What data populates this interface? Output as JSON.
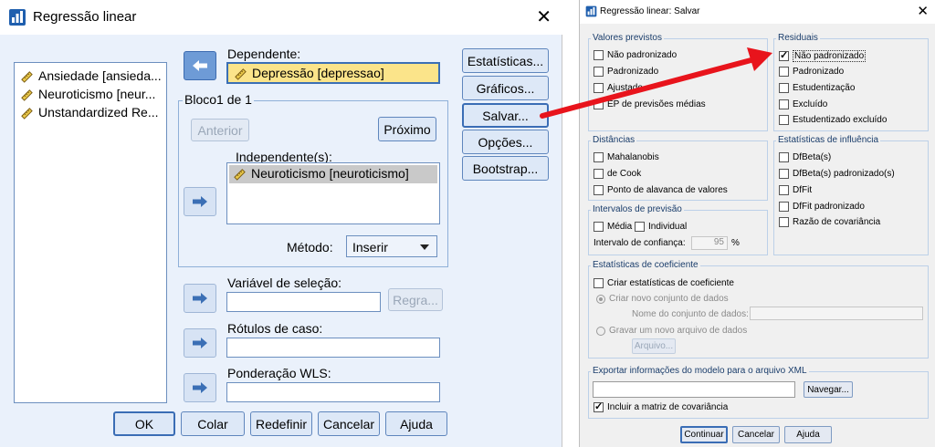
{
  "main_dialog": {
    "title": "Regressão linear",
    "variables": [
      {
        "label": "Ansiedade [ansieda..."
      },
      {
        "label": "Neuroticismo [neur..."
      },
      {
        "label": "Unstandardized Re..."
      }
    ],
    "dependent_label": "Dependente:",
    "dependent_value": "Depressão [depressao]",
    "block_title": "Bloco1 de  1",
    "previous_label": "Anterior",
    "next_label": "Próximo",
    "independent_label": "Independente(s):",
    "independent_values": [
      "Neuroticismo [neuroticismo]"
    ],
    "method_label": "Método:",
    "method_value": "Inserir",
    "selection_label": "Variável de seleção:",
    "rule_label": "Regra...",
    "case_labels_label": "Rótulos de caso:",
    "wls_label": "Ponderação WLS:",
    "side_buttons": [
      "Estatísticas...",
      "Gráficos...",
      "Salvar...",
      "Opções...",
      "Bootstrap..."
    ],
    "footer_buttons": [
      "OK",
      "Colar",
      "Redefinir",
      "Cancelar",
      "Ajuda"
    ]
  },
  "save_dialog": {
    "title": "Regressão linear: Salvar",
    "predicted": {
      "title": "Valores previstos",
      "options": [
        {
          "label": "Não padronizado",
          "checked": false
        },
        {
          "label": "Padronizado",
          "checked": false
        },
        {
          "label": "Ajustado",
          "checked": false
        },
        {
          "label": "EP de previsões médias",
          "checked": false
        }
      ]
    },
    "residuals": {
      "title": "Residuais",
      "options": [
        {
          "label": "Não padronizado",
          "checked": true
        },
        {
          "label": "Padronizado",
          "checked": false
        },
        {
          "label": "Estudentização",
          "checked": false
        },
        {
          "label": "Excluído",
          "checked": false
        },
        {
          "label": "Estudentizado excluído",
          "checked": false
        }
      ]
    },
    "distances": {
      "title": "Distâncias",
      "options": [
        {
          "label": "Mahalanobis",
          "checked": false
        },
        {
          "label": "de Cook",
          "checked": false
        },
        {
          "label": "Ponto de alavanca de valores",
          "checked": false
        }
      ]
    },
    "influence": {
      "title": "Estatísticas de influência",
      "options": [
        {
          "label": "DfBeta(s)",
          "checked": false
        },
        {
          "label": "DfBeta(s) padronizado(s)",
          "checked": false
        },
        {
          "label": "DfFit",
          "checked": false
        },
        {
          "label": "DfFit padronizado",
          "checked": false
        },
        {
          "label": "Razão de covariância",
          "checked": false
        }
      ]
    },
    "prediction_intervals": {
      "title": "Intervalos de previsão",
      "mean_label": "Média",
      "individual_label": "Individual",
      "confidence_label": "Intervalo de confiança:",
      "confidence_value": "95",
      "percent": "%"
    },
    "coefficients": {
      "title": "Estatísticas de coeficiente",
      "create_label": "Criar estatísticas de coeficiente",
      "new_dataset_label": "Criar novo conjunto de dados",
      "dataset_name_label": "Nome do conjunto de dados:",
      "write_file_label": "Gravar um novo arquivo de dados",
      "file_button": "Arquivo..."
    },
    "xml": {
      "title": "Exportar informações do modelo para o arquivo XML",
      "browse_label": "Navegar...",
      "include_cov_label": "Incluir a matriz de covariância",
      "include_cov_checked": true
    },
    "footer_buttons": [
      "Continuar",
      "Cancelar",
      "Ajuda"
    ]
  },
  "colors": {
    "dialog_bg": "#eaf1fb",
    "dependent_highlight": "#fbe48a",
    "annotation_arrow": "#e8141c"
  }
}
